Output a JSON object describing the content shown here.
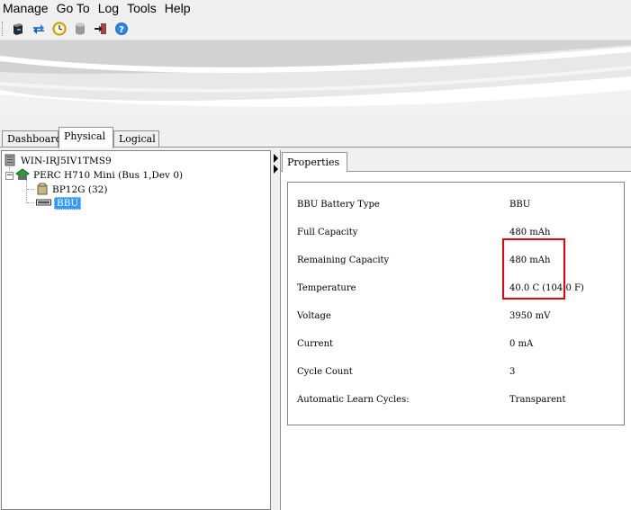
{
  "menu": {
    "items": [
      "Manage",
      "Go To",
      "Log",
      "Tools",
      "Help"
    ]
  },
  "toolbar": {
    "icons": [
      "controller-icon",
      "refresh-icon",
      "clock-icon",
      "database-icon",
      "exit-icon",
      "help-icon"
    ]
  },
  "tabs": {
    "items": [
      "Dashboard",
      "Physical",
      "Logical"
    ],
    "active": "Physical"
  },
  "tree": {
    "server": "WIN-IRJ5IV1TMS9",
    "controller": "PERC H710 Mini (Bus 1,Dev 0)",
    "backplane": "BP12G (32)",
    "battery": "BBU"
  },
  "properties": {
    "tab_label": "Properties",
    "rows": [
      {
        "key": "BBU Battery Type",
        "value": "BBU"
      },
      {
        "key": "Full Capacity",
        "value": "480 mAh"
      },
      {
        "key": "Remaining Capacity",
        "value": "480 mAh"
      },
      {
        "key": "Temperature",
        "value": "40.0 C (104.0 F)"
      },
      {
        "key": "Voltage",
        "value": "3950 mV"
      },
      {
        "key": "Current",
        "value": "0 mA"
      },
      {
        "key": "Cycle Count",
        "value": "3"
      },
      {
        "key": "Automatic Learn Cycles:",
        "value": "Transparent"
      }
    ]
  },
  "colors": {
    "selection": "#3399ff",
    "highlight_box": "#e8000b"
  }
}
